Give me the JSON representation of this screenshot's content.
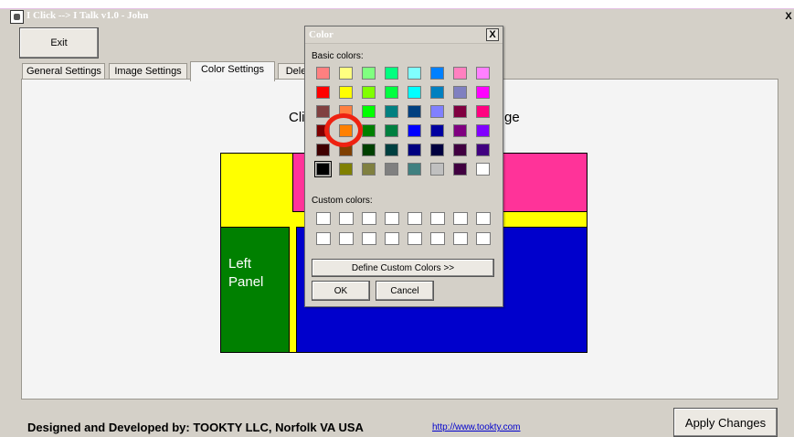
{
  "window": {
    "title": "I Click --> I Talk v1.0 - John",
    "close_glyph": "X"
  },
  "toolbar": {
    "exit_label": "Exit"
  },
  "tabs": [
    {
      "label": "General Settings"
    },
    {
      "label": "Image Settings"
    },
    {
      "label": "Color Settings",
      "active": true
    },
    {
      "label": "Dele"
    }
  ],
  "panel": {
    "caption_start": "Cli",
    "caption_end": "ge",
    "left_panel_label": "Left Panel"
  },
  "layout_colors": {
    "frame": "#ffff00",
    "top_right": "#ff3399",
    "left_panel": "#008000",
    "main": "#0000cc"
  },
  "dialog": {
    "title": "Color",
    "close_glyph": "X",
    "basic_colors_label": "Basic colors:",
    "custom_colors_label": "Custom colors:",
    "basic_colors": [
      [
        "#ff8080",
        "#ffff80",
        "#80ff80",
        "#00ff80",
        "#80ffff",
        "#0080ff",
        "#ff80c0",
        "#ff80ff"
      ],
      [
        "#ff0000",
        "#ffff00",
        "#80ff00",
        "#00ff40",
        "#00ffff",
        "#0080c0",
        "#8080c0",
        "#ff00ff"
      ],
      [
        "#804040",
        "#ff8040",
        "#00ff00",
        "#008080",
        "#004080",
        "#8080ff",
        "#800040",
        "#ff0080"
      ],
      [
        "#800000",
        "#ff8000",
        "#008000",
        "#008040",
        "#0000ff",
        "#0000a0",
        "#800080",
        "#8000ff"
      ],
      [
        "#400000",
        "#804000",
        "#004000",
        "#004040",
        "#000080",
        "#000040",
        "#400040",
        "#400080"
      ],
      [
        "#000000",
        "#808000",
        "#808040",
        "#808080",
        "#408080",
        "#c0c0c0",
        "#400040",
        "#ffffff"
      ]
    ],
    "selected_color": "#000000",
    "custom_colors_count": 16,
    "define_custom_label": "Define Custom Colors >>",
    "ok_label": "OK",
    "cancel_label": "Cancel"
  },
  "footer": {
    "credit": "Designed and Developed by: TOOKTY    LLC,  Norfolk VA USA",
    "link": "http://www.tookty.com",
    "apply_label": "Apply Changes"
  },
  "highlight": {
    "ring_color": "#ee2211"
  }
}
